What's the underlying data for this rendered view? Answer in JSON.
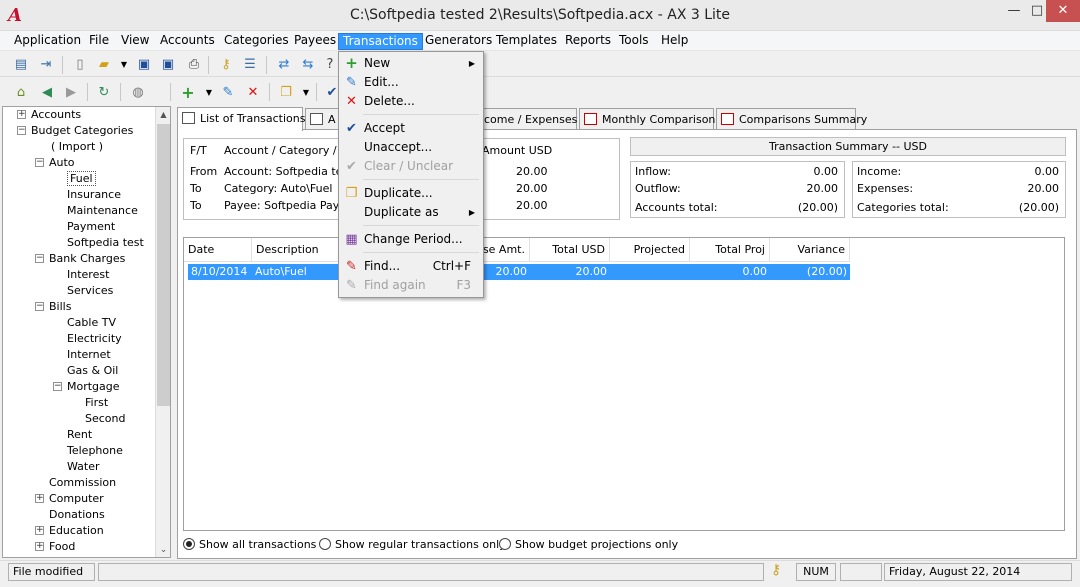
{
  "window": {
    "title": "C:\\Softpedia tested 2\\Results\\Softpedia.acx - AX 3 Lite",
    "logo": "A",
    "minimize": "—",
    "maximize": "□",
    "close": "✕"
  },
  "menubar": [
    "Application",
    "File",
    "View",
    "Accounts",
    "Categories",
    "Payees",
    "Transactions",
    "Generators",
    "Templates",
    "Reports",
    "Tools",
    "Help"
  ],
  "transactions_menu": {
    "new": "New",
    "edit": "Edit...",
    "delete": "Delete...",
    "accept": "Accept",
    "unaccept": "Unaccept...",
    "clear": "Clear / Unclear",
    "duplicate": "Duplicate...",
    "duplicate_as": "Duplicate as",
    "change_period": "Change Period...",
    "find": "Find...",
    "find_shortcut": "Ctrl+F",
    "find_again": "Find again",
    "find_again_shortcut": "F3"
  },
  "tree": [
    "Accounts",
    "Budget Categories",
    "( Import )",
    "Auto",
    "Fuel",
    "Insurance",
    "Maintenance",
    "Payment",
    "Softpedia test",
    "Bank Charges",
    "Interest",
    "Services",
    "Bills",
    "Cable TV",
    "Electricity",
    "Internet",
    "Gas & Oil",
    "Mortgage",
    "First",
    "Second",
    "Rent",
    "Telephone",
    "Water",
    "Commission",
    "Computer",
    "Donations",
    "Education",
    "Food"
  ],
  "tabs": [
    "List of Transactions",
    "A",
    "come / Expenses",
    "Monthly Comparisons",
    "Comparisons Summary"
  ],
  "detail": {
    "headers": [
      "F/T",
      "Account / Category / P...",
      "Amount USD"
    ],
    "rows": [
      [
        "From",
        "Account: Softpedia test",
        "20.00"
      ],
      [
        "To",
        "Category: Auto\\Fuel",
        "20.00"
      ],
      [
        "To",
        "Payee: Softpedia Payee",
        "20.00"
      ]
    ]
  },
  "summary": {
    "title": "Transaction Summary -- USD",
    "left": [
      [
        "Inflow:",
        "0.00"
      ],
      [
        "Outflow:",
        "20.00"
      ],
      [
        "Accounts total:",
        "(20.00)"
      ]
    ],
    "right": [
      [
        "Income:",
        "0.00"
      ],
      [
        "Expenses:",
        "20.00"
      ],
      [
        "Categories total:",
        "(20.00)"
      ]
    ]
  },
  "grid": {
    "headers": [
      "Date",
      "Description",
      "nse Amt.",
      "Total USD",
      "Projected",
      "Total Proj",
      "Variance"
    ],
    "row": [
      "8/10/2014",
      "Auto\\Fuel",
      "20.00",
      "20.00",
      "0.00",
      "(20.00)"
    ]
  },
  "filters": [
    "Show all transactions",
    "Show regular transactions only",
    "Show budget projections only"
  ],
  "status": {
    "left": "File modified",
    "num": "NUM",
    "date": "Friday, August 22, 2014"
  }
}
